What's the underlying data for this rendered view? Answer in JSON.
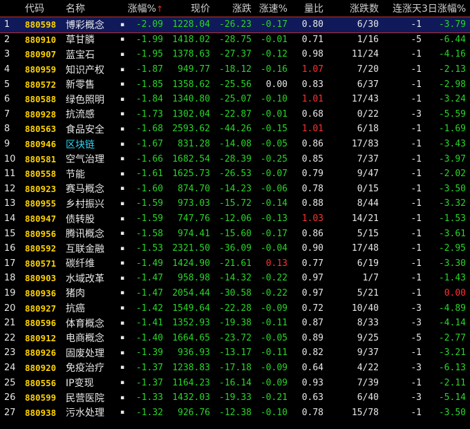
{
  "columns": {
    "idx": "",
    "code": "代码",
    "name": "名称",
    "chg": "涨幅%",
    "sort_arrow": "↑",
    "price": "现价",
    "diff": "涨跌",
    "speed": "涨速%",
    "vr": "量比",
    "ud": "涨跌数",
    "days": "连涨天",
    "d3": "3日涨幅%"
  },
  "colors": {
    "green": "#28d628",
    "red": "#ff3030",
    "yellow": "#ffd400",
    "cyan": "#2fd4f0",
    "selected": "#101a5a"
  },
  "rows": [
    {
      "idx": "1",
      "code": "880598",
      "name": "博彩概念",
      "dot": "▪",
      "chg": "-2.09",
      "price": "1228.04",
      "diff": "-26.23",
      "speed": "-0.17",
      "vr": "0.80",
      "ud": "6/30",
      "days": "-1",
      "d3": "-3.79",
      "selected": true
    },
    {
      "idx": "2",
      "code": "880910",
      "name": "草甘膦",
      "dot": "▪",
      "chg": "-1.99",
      "price": "1418.02",
      "diff": "-28.75",
      "speed": "-0.01",
      "vr": "0.71",
      "ud": "1/16",
      "days": "-5",
      "d3": "-6.44"
    },
    {
      "idx": "3",
      "code": "880907",
      "name": "蓝宝石",
      "dot": "▪",
      "chg": "-1.95",
      "price": "1378.63",
      "diff": "-27.37",
      "speed": "-0.12",
      "vr": "0.98",
      "ud": "11/24",
      "days": "-1",
      "d3": "-4.16"
    },
    {
      "idx": "4",
      "code": "880959",
      "name": "知识产权",
      "dot": "▪",
      "chg": "-1.87",
      "price": "949.77",
      "diff": "-18.12",
      "speed": "-0.16",
      "vr": "1.07",
      "vr_red": true,
      "ud": "7/20",
      "days": "-1",
      "d3": "-2.13"
    },
    {
      "idx": "5",
      "code": "880572",
      "name": "新零售",
      "dot": "▪",
      "chg": "-1.85",
      "price": "1358.62",
      "diff": "-25.56",
      "speed": "0.00",
      "speed_white": true,
      "vr": "0.83",
      "ud": "6/37",
      "days": "-1",
      "d3": "-2.98"
    },
    {
      "idx": "6",
      "code": "880588",
      "name": "绿色照明",
      "dot": "▪",
      "chg": "-1.84",
      "price": "1340.80",
      "diff": "-25.07",
      "speed": "-0.10",
      "vr": "1.01",
      "vr_red": true,
      "ud": "17/43",
      "days": "-1",
      "d3": "-3.24"
    },
    {
      "idx": "7",
      "code": "880928",
      "name": "抗流感",
      "dot": "▪",
      "chg": "-1.73",
      "price": "1302.04",
      "diff": "-22.87",
      "speed": "-0.01",
      "vr": "0.68",
      "ud": "0/22",
      "days": "-3",
      "d3": "-5.59"
    },
    {
      "idx": "8",
      "code": "880563",
      "name": "食品安全",
      "dot": "▪",
      "chg": "-1.68",
      "price": "2593.62",
      "diff": "-44.26",
      "speed": "-0.15",
      "vr": "1.01",
      "vr_red": true,
      "ud": "6/18",
      "days": "-1",
      "d3": "-1.69"
    },
    {
      "idx": "9",
      "code": "880946",
      "name": "区块链",
      "dot": "▪",
      "name_cyan": true,
      "chg": "-1.67",
      "price": "831.28",
      "diff": "-14.08",
      "speed": "-0.05",
      "vr": "0.86",
      "ud": "17/83",
      "days": "-1",
      "d3": "-3.43"
    },
    {
      "idx": "10",
      "code": "880581",
      "name": "空气治理",
      "dot": "▪",
      "chg": "-1.66",
      "price": "1682.54",
      "diff": "-28.39",
      "speed": "-0.25",
      "vr": "0.85",
      "ud": "7/37",
      "days": "-1",
      "d3": "-3.97"
    },
    {
      "idx": "11",
      "code": "880558",
      "name": "节能",
      "dot": "▪",
      "chg": "-1.61",
      "price": "1625.73",
      "diff": "-26.53",
      "speed": "-0.07",
      "vr": "0.79",
      "ud": "9/47",
      "days": "-1",
      "d3": "-2.02"
    },
    {
      "idx": "12",
      "code": "880923",
      "name": "赛马概念",
      "dot": "▪",
      "chg": "-1.60",
      "price": "874.70",
      "diff": "-14.23",
      "speed": "-0.06",
      "vr": "0.78",
      "ud": "0/15",
      "days": "-1",
      "d3": "-3.50"
    },
    {
      "idx": "13",
      "code": "880955",
      "name": "乡村振兴",
      "dot": "▪",
      "chg": "-1.59",
      "price": "973.03",
      "diff": "-15.72",
      "speed": "-0.14",
      "vr": "0.88",
      "ud": "8/44",
      "days": "-1",
      "d3": "-3.32"
    },
    {
      "idx": "14",
      "code": "880947",
      "name": "债转股",
      "dot": "▪",
      "chg": "-1.59",
      "price": "747.76",
      "diff": "-12.06",
      "speed": "-0.13",
      "vr": "1.03",
      "vr_red": true,
      "ud": "14/21",
      "days": "-1",
      "d3": "-1.53"
    },
    {
      "idx": "15",
      "code": "880956",
      "name": "腾讯概念",
      "dot": "▪",
      "chg": "-1.58",
      "price": "974.41",
      "diff": "-15.60",
      "speed": "-0.17",
      "vr": "0.86",
      "ud": "5/15",
      "days": "-1",
      "d3": "-3.61"
    },
    {
      "idx": "16",
      "code": "880592",
      "name": "互联金融",
      "dot": "▪",
      "chg": "-1.53",
      "price": "2321.50",
      "diff": "-36.09",
      "speed": "-0.04",
      "vr": "0.90",
      "ud": "17/48",
      "days": "-1",
      "d3": "-2.95"
    },
    {
      "idx": "17",
      "code": "880571",
      "name": "碳纤维",
      "dot": "▪",
      "chg": "-1.49",
      "price": "1424.90",
      "diff": "-21.61",
      "speed": "0.13",
      "speed_red": true,
      "vr": "0.77",
      "ud": "6/19",
      "days": "-1",
      "d3": "-3.30"
    },
    {
      "idx": "18",
      "code": "880903",
      "name": "水域改革",
      "dot": "▪",
      "chg": "-1.47",
      "price": "958.98",
      "diff": "-14.32",
      "speed": "-0.22",
      "vr": "0.97",
      "ud": "1/7",
      "days": "-1",
      "d3": "-1.43"
    },
    {
      "idx": "19",
      "code": "880936",
      "name": "猪肉",
      "dot": "▪",
      "chg": "-1.47",
      "price": "2054.44",
      "diff": "-30.58",
      "speed": "-0.22",
      "vr": "0.97",
      "ud": "5/21",
      "days": "-1",
      "d3": "0.00",
      "d3_red": true
    },
    {
      "idx": "20",
      "code": "880927",
      "name": "抗癌",
      "dot": "▪",
      "chg": "-1.42",
      "price": "1549.64",
      "diff": "-22.28",
      "speed": "-0.09",
      "vr": "0.72",
      "ud": "10/40",
      "days": "-3",
      "d3": "-4.89"
    },
    {
      "idx": "21",
      "code": "880596",
      "name": "体育概念",
      "dot": "▪",
      "chg": "-1.41",
      "price": "1352.93",
      "diff": "-19.38",
      "speed": "-0.11",
      "vr": "0.87",
      "ud": "8/33",
      "days": "-3",
      "d3": "-4.14"
    },
    {
      "idx": "22",
      "code": "880912",
      "name": "电商概念",
      "dot": "▪",
      "chg": "-1.40",
      "price": "1664.65",
      "diff": "-23.72",
      "speed": "-0.05",
      "vr": "0.89",
      "ud": "9/25",
      "days": "-5",
      "d3": "-2.77"
    },
    {
      "idx": "23",
      "code": "880926",
      "name": "固废处理",
      "dot": "▪",
      "chg": "-1.39",
      "price": "936.93",
      "diff": "-13.17",
      "speed": "-0.11",
      "vr": "0.82",
      "ud": "9/37",
      "days": "-1",
      "d3": "-3.21"
    },
    {
      "idx": "24",
      "code": "880920",
      "name": "免疫治疗",
      "dot": "▪",
      "chg": "-1.37",
      "price": "1238.83",
      "diff": "-17.18",
      "speed": "-0.09",
      "vr": "0.64",
      "ud": "4/22",
      "days": "-3",
      "d3": "-6.13"
    },
    {
      "idx": "25",
      "code": "880556",
      "name": "IP变现",
      "dot": "▪",
      "chg": "-1.37",
      "price": "1164.23",
      "diff": "-16.14",
      "speed": "-0.09",
      "vr": "0.93",
      "ud": "7/39",
      "days": "-1",
      "d3": "-2.11"
    },
    {
      "idx": "26",
      "code": "880599",
      "name": "民营医院",
      "dot": "▪",
      "chg": "-1.33",
      "price": "1432.03",
      "diff": "-19.33",
      "speed": "-0.21",
      "vr": "0.63",
      "ud": "6/40",
      "days": "-3",
      "d3": "-5.14"
    },
    {
      "idx": "27",
      "code": "880938",
      "name": "污水处理",
      "dot": "▪",
      "chg": "-1.32",
      "price": "926.76",
      "diff": "-12.38",
      "speed": "-0.10",
      "vr": "0.78",
      "ud": "15/78",
      "days": "-1",
      "d3": "-3.50"
    }
  ]
}
